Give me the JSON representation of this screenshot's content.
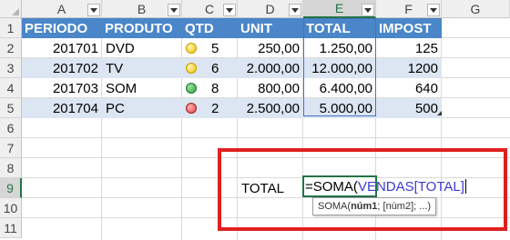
{
  "columns": [
    "A",
    "B",
    "C",
    "D",
    "E",
    "F",
    "G"
  ],
  "selected_column": "E",
  "rows": [
    "1",
    "2",
    "3",
    "4",
    "5",
    "6",
    "7",
    "8",
    "9",
    "10",
    "11"
  ],
  "selected_row": "9",
  "table": {
    "headers": [
      "PERIODO",
      "PRODUTO",
      "QTD",
      "UNIT",
      "TOTAL",
      "IMPOST"
    ],
    "records": [
      {
        "periodo": "201701",
        "produto": "DVD",
        "icon": "yellow-circle-icon",
        "qtd": "5",
        "unit": "250,00",
        "total": "1.250,00",
        "impost": "125"
      },
      {
        "periodo": "201702",
        "produto": "TV",
        "icon": "yellow-circle-icon",
        "qtd": "6",
        "unit": "2.000,00",
        "total": "12.000,00",
        "impost": "1200"
      },
      {
        "periodo": "201703",
        "produto": "SOM",
        "icon": "green-circle-icon",
        "qtd": "8",
        "unit": "800,00",
        "total": "6.400,00",
        "impost": "640"
      },
      {
        "periodo": "201704",
        "produto": "PC",
        "icon": "red-circle-icon",
        "qtd": "2",
        "unit": "2.500,00",
        "total": "5.000,00",
        "impost": "500"
      }
    ]
  },
  "total_label": "TOTAL",
  "formula": {
    "prefix": "=SOMA(",
    "argument": "VENDAS[TOTAL]"
  },
  "tooltip": {
    "func": "SOMA(",
    "arg1": "núm1",
    "rest": "; [núm2]; ...)"
  },
  "colors": {
    "header_fill": "#4a86c8",
    "band_fill": "#dce6f2",
    "highlight_border": "#e02020",
    "formula_ref": "#3b3bd6"
  }
}
